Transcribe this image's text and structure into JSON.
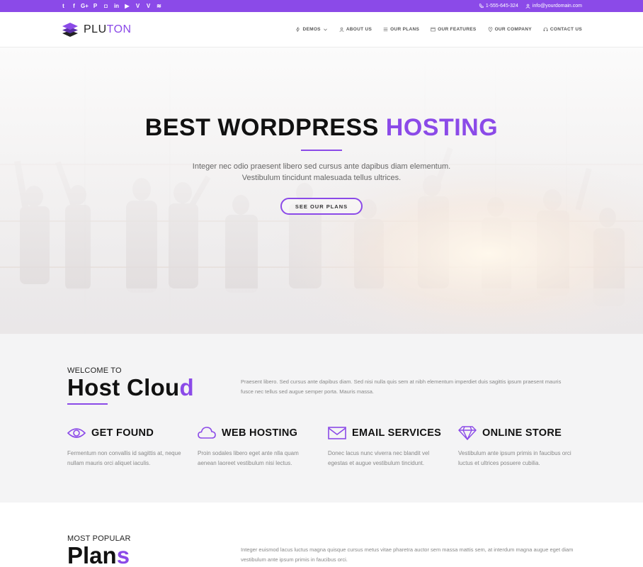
{
  "topbar": {
    "social_icons": [
      "twitter-icon",
      "facebook-icon",
      "google-plus-icon",
      "pinterest-icon",
      "instagram-icon",
      "linkedin-icon",
      "youtube-icon",
      "vimeo-icon",
      "vine-icon",
      "rss-icon"
    ],
    "social_glyphs": [
      "t",
      "f",
      "G+",
      "P",
      "◘",
      "in",
      "▶",
      "V",
      "V",
      "≋"
    ],
    "phone": "1-555-645-324",
    "email": "info@yourdomain.com"
  },
  "header": {
    "logo_text_a": "PLU",
    "logo_text_b": "TON",
    "nav": [
      {
        "label": "DEMOS",
        "icon": "bolt-icon"
      },
      {
        "label": "ABOUT US",
        "icon": "user-icon"
      },
      {
        "label": "OUR PLANS",
        "icon": "list-icon"
      },
      {
        "label": "OUR FEATURES",
        "icon": "window-icon"
      },
      {
        "label": "OUR COMPANY",
        "icon": "map-pin-icon"
      },
      {
        "label": "CONTACT US",
        "icon": "headset-icon"
      }
    ]
  },
  "hero": {
    "title_a": "BEST WORDPRESS ",
    "title_b": "HOSTING",
    "text_line1": "Integer nec odio praesent libero sed cursus ante dapibus diam elementum.",
    "text_line2": "Vestibulum tincidunt malesuada tellus ultrices.",
    "button": "SEE OUR PLANS"
  },
  "welcome": {
    "kicker": "WELCOME TO",
    "title_a": "Host Clou",
    "title_b": "d",
    "paragraph": "Praesent libero. Sed cursus ante dapibus diam. Sed nisi nulla quis sem at nibh elementum imperdiet duis sagittis ipsum praesent mauris fusce nec tellus sed augue semper porta. Mauris massa.",
    "features": [
      {
        "title": "GET FOUND",
        "icon": "eye-icon",
        "text": "Fermentum non convallis id sagittis at, neque nullam mauris orci aliquet iaculis."
      },
      {
        "title": "WEB HOSTING",
        "icon": "cloud-icon",
        "text": "Proin sodales libero eget ante nlla quam aenean laoreet vestibulum nisi lectus."
      },
      {
        "title": "EMAIL SERVICES",
        "icon": "envelope-icon",
        "text": "Donec lacus nunc viverra nec blandit vel egestas et augue vestibulum tincidunt."
      },
      {
        "title": "ONLINE STORE",
        "icon": "diamond-icon",
        "text": "Vestibulum ante ipsum primis in faucibus orci luctus et ultrices posuere cubilia."
      }
    ]
  },
  "plans": {
    "kicker": "MOST POPULAR",
    "title_a": "Plan",
    "title_b": "s",
    "paragraph": "Integer euismod lacus luctus magna quisque cursus metus vitae pharetra auctor sem massa mattis sem, at interdum magna augue eget diam vestibulum ante ipsum primis in faucibus orci."
  },
  "colors": {
    "accent": "#8b4ae8",
    "topbar": "#8b4ae8",
    "section_bg": "#f4f4f5"
  }
}
